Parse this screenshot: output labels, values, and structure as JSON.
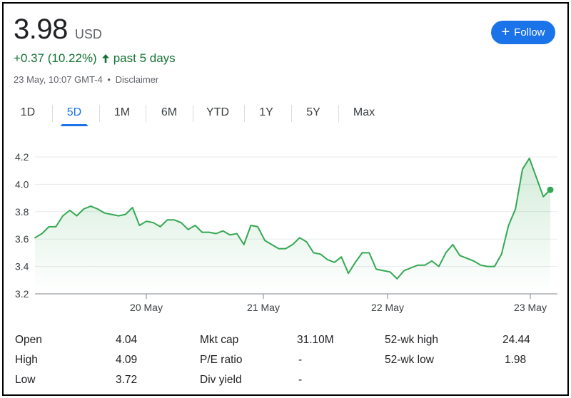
{
  "quote": {
    "price": "3.98",
    "currency": "USD",
    "change_text": "+0.37 (10.22%)",
    "period_text": "past 5 days",
    "timestamp": "23 May, 10:07 GMT-4",
    "separator": "•",
    "disclaimer": "Disclaimer"
  },
  "follow_button": {
    "label": "Follow"
  },
  "tabs": [
    {
      "label": "1D",
      "active": false
    },
    {
      "label": "5D",
      "active": true
    },
    {
      "label": "1M",
      "active": false
    },
    {
      "label": "6M",
      "active": false
    },
    {
      "label": "YTD",
      "active": false
    },
    {
      "label": "1Y",
      "active": false
    },
    {
      "label": "5Y",
      "active": false
    },
    {
      "label": "Max",
      "active": false
    }
  ],
  "colors": {
    "positive": "#137333",
    "line": "#34a853",
    "accent": "#1a73e8",
    "grid": "#e8eaed"
  },
  "chart_data": {
    "type": "line",
    "ylim": [
      3.2,
      4.2
    ],
    "yticks": [
      3.2,
      3.4,
      3.6,
      3.8,
      4.0,
      4.2
    ],
    "ytick_labels": [
      "3.2",
      "3.4",
      "3.6",
      "3.8",
      "4.0",
      "4.2"
    ],
    "x_tick_labels": [
      "20 May",
      "21 May",
      "22 May",
      "23 May"
    ],
    "grid": true,
    "series": [
      {
        "values": [
          3.61,
          3.64,
          3.69,
          3.69,
          3.77,
          3.81,
          3.77,
          3.82,
          3.84,
          3.82,
          3.79,
          3.78,
          3.77,
          3.78,
          3.83,
          3.7,
          3.73,
          3.72,
          3.69,
          3.74,
          3.74,
          3.72,
          3.67,
          3.7,
          3.65,
          3.65,
          3.64,
          3.66,
          3.63,
          3.64,
          3.56,
          3.7,
          3.69,
          3.59,
          3.56,
          3.53,
          3.53,
          3.56,
          3.61,
          3.58,
          3.5,
          3.49,
          3.45,
          3.43,
          3.47,
          3.35,
          3.43,
          3.5,
          3.5,
          3.38,
          3.37,
          3.36,
          3.31,
          3.37,
          3.39,
          3.41,
          3.41,
          3.44,
          3.4,
          3.5,
          3.56,
          3.48,
          3.46,
          3.44,
          3.41,
          3.4,
          3.4,
          3.49,
          3.7,
          3.82,
          4.11,
          4.19,
          4.05,
          3.91,
          3.96
        ]
      }
    ]
  },
  "stats": {
    "col1": [
      {
        "label": "Open",
        "value": "4.04"
      },
      {
        "label": "High",
        "value": "4.09"
      },
      {
        "label": "Low",
        "value": "3.72"
      }
    ],
    "col2": [
      {
        "label": "Mkt cap",
        "value": "31.10M"
      },
      {
        "label": "P/E ratio",
        "value": "-"
      },
      {
        "label": "Div yield",
        "value": "-"
      }
    ],
    "col3": [
      {
        "label": "52-wk high",
        "value": "24.44"
      },
      {
        "label": "52-wk low",
        "value": "1.98"
      }
    ]
  }
}
